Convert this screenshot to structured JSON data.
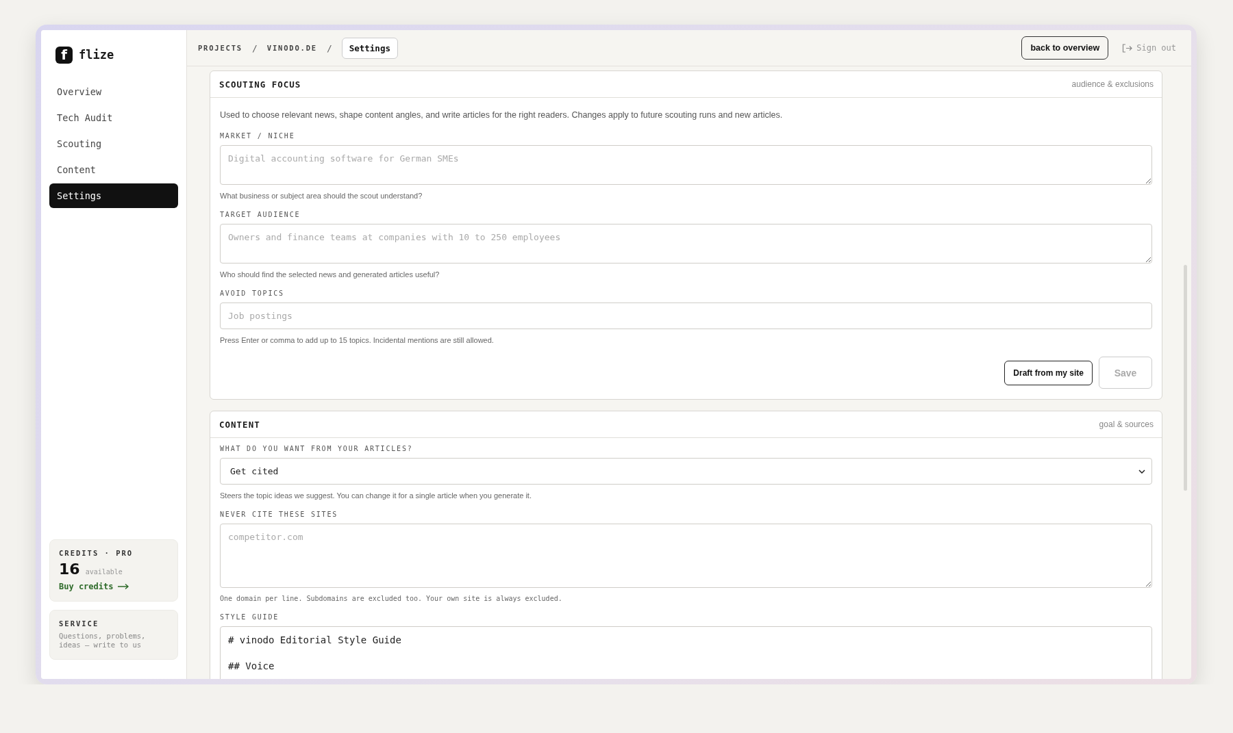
{
  "brand": {
    "mark": "f",
    "name": "flize"
  },
  "nav": [
    {
      "label": "Overview",
      "selected": false
    },
    {
      "label": "Tech Audit",
      "selected": false
    },
    {
      "label": "Scouting",
      "selected": false
    },
    {
      "label": "Content",
      "selected": false
    },
    {
      "label": "Settings",
      "selected": true
    }
  ],
  "credits": {
    "title": "CREDITS · PRO",
    "count": "16",
    "count_label": "available",
    "link": "Buy credits"
  },
  "service": {
    "title": "SERVICE",
    "text": "Questions, problems, ideas — write to us"
  },
  "breadcrumb": {
    "separator": "/",
    "items": [
      {
        "label": "PROJECTS",
        "current": false
      },
      {
        "label": "VINODO.DE",
        "current": false
      },
      {
        "label": "Settings",
        "current": true
      }
    ]
  },
  "header": {
    "back": "back to overview",
    "sign_out": "Sign out"
  },
  "sections": [
    {
      "title": "SCOUTING FOCUS",
      "subtitle": "audience & exclusions",
      "description": "Used to choose relevant news, shape content angles, and write articles for the right readers. Changes apply to future scouting runs and new articles.",
      "fields": [
        {
          "kind": "textarea",
          "label": "MARKET / NICHE",
          "placeholder": "Digital accounting software for German SMEs",
          "help": "What business or subject area should the scout understand?"
        },
        {
          "kind": "textarea",
          "label": "TARGET AUDIENCE",
          "placeholder": "Owners and finance teams at companies with 10 to 250 employees",
          "help": "Who should find the selected news and generated articles useful?"
        },
        {
          "kind": "input",
          "label": "AVOID TOPICS",
          "placeholder": "Job postings",
          "help": "Press Enter or comma to add up to 15 topics. Incidental mentions are still allowed."
        }
      ],
      "buttons": [
        {
          "label": "Draft from my site",
          "disabled": false
        },
        {
          "label": "Save",
          "disabled": true
        }
      ]
    },
    {
      "title": "CONTENT",
      "subtitle": "goal & sources",
      "fields": [
        {
          "kind": "select",
          "label": "WHAT DO YOU WANT FROM YOUR ARTICLES?",
          "value": "Get cited",
          "help": "Steers the topic ideas we suggest. You can change it for a single article when you generate it."
        },
        {
          "kind": "textarea-tall",
          "label": "NEVER CITE THESE SITES",
          "placeholder": "competitor.com",
          "help": "One domain per line. Subdomains are excluded too. Your own site is always excluded."
        },
        {
          "kind": "editor",
          "label": "STYLE GUIDE",
          "value": "# vinodo Editorial Style Guide\n\n## Voice"
        }
      ]
    }
  ]
}
